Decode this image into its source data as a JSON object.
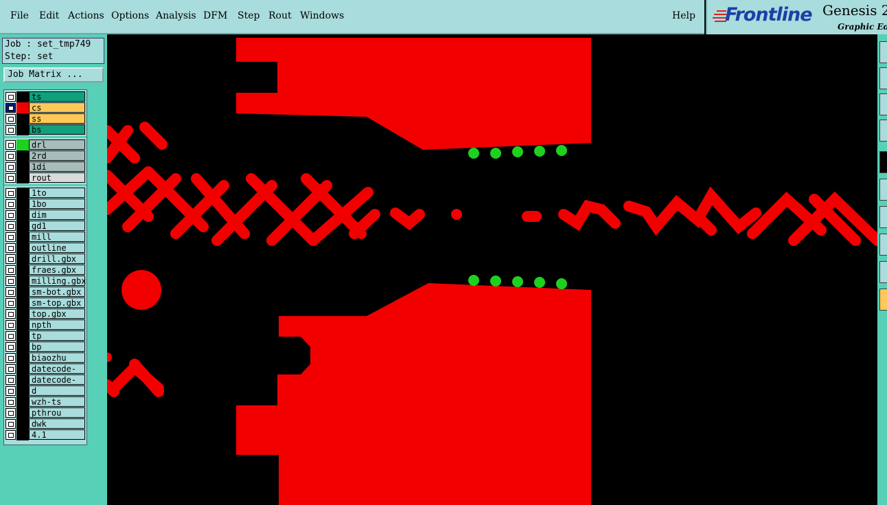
{
  "menu": {
    "file": "File",
    "edit": "Edit",
    "actions": "Actions",
    "options": "Options",
    "analysis": "Analysis",
    "dfm": "DFM",
    "step": "Step",
    "rout": "Rout",
    "windows": "Windows",
    "help": "Help"
  },
  "brand": {
    "logo": "Frontline",
    "title": "Genesis 2",
    "subtitle": "Graphic Edi"
  },
  "job": {
    "job_line": "Job : set_tmp749",
    "step_line": "Step: set",
    "matrix_button": "Job Matrix ..."
  },
  "colors": {
    "ts": "#11a07c",
    "cs": "#ffc95a",
    "ss": "#ffc95a",
    "bs": "#11a07c",
    "drill": "#a8bcbc",
    "rout": "#d9dada",
    "other": "#a9dcdc",
    "copper": "#f20000",
    "drill_mark": "#1fd11f"
  },
  "layers": {
    "board": [
      {
        "name": "ts",
        "checked": false,
        "swatch": "#000000",
        "color": "#11a07c"
      },
      {
        "name": "cs",
        "checked": true,
        "swatch": "#f20000",
        "color": "#ffc95a"
      },
      {
        "name": "ss",
        "checked": false,
        "swatch": "#000000",
        "color": "#ffc95a"
      },
      {
        "name": "bs",
        "checked": false,
        "swatch": "#000000",
        "color": "#11a07c"
      }
    ],
    "drill": [
      {
        "name": "drl",
        "checked": false,
        "swatch": "#1fd11f",
        "color": "#a8bcbc"
      },
      {
        "name": "2rd",
        "checked": false,
        "swatch": "#000000",
        "color": "#a8bcbc"
      },
      {
        "name": "1di",
        "checked": false,
        "swatch": "#000000",
        "color": "#a8bcbc"
      },
      {
        "name": "rout",
        "checked": false,
        "swatch": "#000000",
        "color": "#d9dada"
      }
    ],
    "misc": [
      {
        "name": "1to"
      },
      {
        "name": "1bo"
      },
      {
        "name": "dim"
      },
      {
        "name": "gd1"
      },
      {
        "name": "mill"
      },
      {
        "name": "outline"
      },
      {
        "name": "drill.gbx"
      },
      {
        "name": "fraes.gbx"
      },
      {
        "name": "milling.gbx"
      },
      {
        "name": "sm-bot.gbx"
      },
      {
        "name": "sm-top.gbx"
      },
      {
        "name": "top.gbx"
      },
      {
        "name": "npth"
      },
      {
        "name": "tp"
      },
      {
        "name": "bp"
      },
      {
        "name": "biaozhu"
      },
      {
        "name": "datecode-ts"
      },
      {
        "name": "datecode-bs"
      },
      {
        "name": "d"
      },
      {
        "name": "wzh-ts"
      },
      {
        "name": "pthrou"
      },
      {
        "name": "dwk"
      },
      {
        "name": "4.1"
      }
    ]
  }
}
